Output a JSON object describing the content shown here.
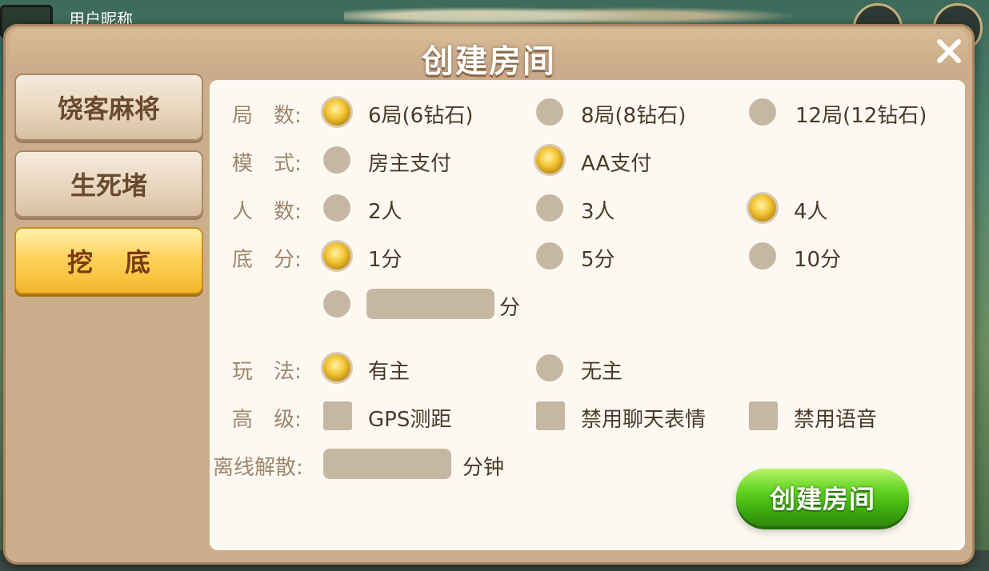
{
  "background": {
    "nickname": "用户昵称"
  },
  "dialog": {
    "title": "创建房间",
    "close_icon": "close-icon"
  },
  "tabs": [
    {
      "label": "饶客麻将",
      "active": false
    },
    {
      "label": "生死堵",
      "active": false
    },
    {
      "label": "挖底",
      "active": true
    }
  ],
  "form": {
    "rounds": {
      "label": "局　数:",
      "options": [
        {
          "text": "6局(6钻石)",
          "selected": true
        },
        {
          "text": "8局(8钻石)",
          "selected": false
        },
        {
          "text": "12局(12钻石)",
          "selected": false
        }
      ]
    },
    "mode": {
      "label": "模　式:",
      "options": [
        {
          "text": "房主支付",
          "selected": false
        },
        {
          "text": "AA支付",
          "selected": true
        }
      ]
    },
    "players": {
      "label": "人　数:",
      "options": [
        {
          "text": "2人",
          "selected": false
        },
        {
          "text": "3人",
          "selected": false
        },
        {
          "text": "4人",
          "selected": true
        }
      ]
    },
    "base_score": {
      "label": "底　分:",
      "options": [
        {
          "text": "1分",
          "selected": true
        },
        {
          "text": "5分",
          "selected": false
        },
        {
          "text": "10分",
          "selected": false
        }
      ],
      "custom_value": "",
      "custom_unit": "分"
    },
    "play": {
      "label": "玩　法:",
      "options": [
        {
          "text": "有主",
          "selected": true
        },
        {
          "text": "无主",
          "selected": false
        }
      ]
    },
    "advanced": {
      "label": "高　级:",
      "options": [
        {
          "text": "GPS测距",
          "checked": false
        },
        {
          "text": "禁用聊天表情",
          "checked": false
        },
        {
          "text": "禁用语音",
          "checked": false
        }
      ]
    },
    "offline_dismiss": {
      "label": "离线解散:",
      "value": "",
      "unit": "分钟"
    }
  },
  "create_button": "创建房间",
  "colors": {
    "accent_gold": "#f4c636",
    "button_green": "#3aa80d",
    "panel_bg": "#fdf9f2",
    "frame": "#cdae8c"
  }
}
